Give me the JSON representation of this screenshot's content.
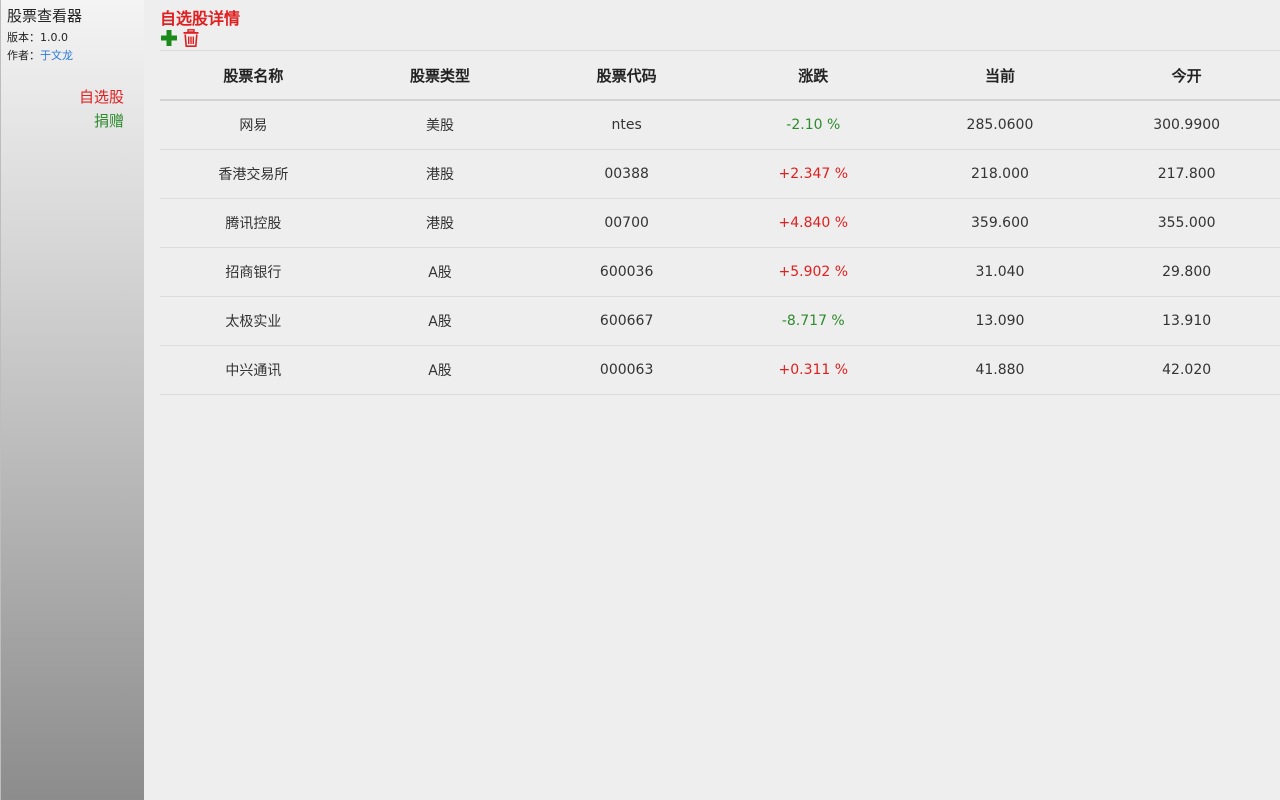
{
  "app": {
    "title": "股票查看器",
    "version_label": "版本：",
    "version_value": "1.0.0",
    "author_label": "作者：",
    "author_name": "于文龙"
  },
  "sidebar": {
    "items": [
      {
        "label": "自选股",
        "color": "#e02020",
        "active": true
      },
      {
        "label": "捐赠",
        "color": "#2e8b2e",
        "active": false
      }
    ]
  },
  "main": {
    "title": "自选股详情",
    "title_color": "#e02020",
    "toolbar": {
      "add_icon": "plus-icon",
      "add_color": "#1a8a1a",
      "delete_icon": "trash-icon",
      "delete_color": "#e02020"
    }
  },
  "table": {
    "columns": [
      "股票名称",
      "股票类型",
      "股票代码",
      "涨跌",
      "当前",
      "今开"
    ],
    "rows": [
      {
        "name": "网易",
        "type": "美股",
        "code": "ntes",
        "change": "-2.10 %",
        "current": "285.0600",
        "open": "300.9900"
      },
      {
        "name": "香港交易所",
        "type": "港股",
        "code": "00388",
        "change": "+2.347 %",
        "current": "218.000",
        "open": "217.800"
      },
      {
        "name": "腾讯控股",
        "type": "港股",
        "code": "00700",
        "change": "+4.840 %",
        "current": "359.600",
        "open": "355.000"
      },
      {
        "name": "招商银行",
        "type": "A股",
        "code": "600036",
        "change": "+5.902 %",
        "current": "31.040",
        "open": "29.800"
      },
      {
        "name": "太极实业",
        "type": "A股",
        "code": "600667",
        "change": "-8.717 %",
        "current": "13.090",
        "open": "13.910"
      },
      {
        "name": "中兴通讯",
        "type": "A股",
        "code": "000063",
        "change": "+0.311 %",
        "current": "41.880",
        "open": "42.020"
      }
    ],
    "up_color": "#e02020",
    "down_color": "#2e8b2e"
  }
}
